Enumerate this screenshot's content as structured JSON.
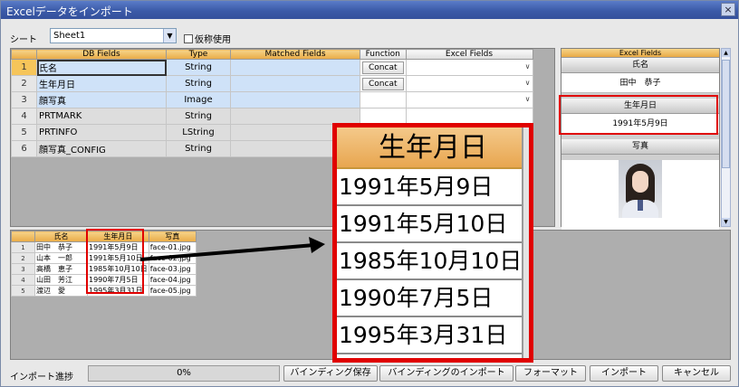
{
  "window": {
    "title": "Excelデータをインポート",
    "close": "×"
  },
  "sheet": {
    "label": "シート",
    "value": "Sheet1",
    "alias_label": "仮称使用"
  },
  "mapping": {
    "headers": {
      "db": "DB Fields",
      "type": "Type",
      "matched": "Matched Fields",
      "function": "Function",
      "excel": "Excel Fields"
    },
    "rows": [
      {
        "num": "1",
        "db": "氏名",
        "type": "String",
        "func": "Concat"
      },
      {
        "num": "2",
        "db": "生年月日",
        "type": "String",
        "func": "Concat"
      },
      {
        "num": "3",
        "db": "顔写真",
        "type": "Image",
        "func": ""
      },
      {
        "num": "4",
        "db": "PRTMARK",
        "type": "String",
        "func": ""
      },
      {
        "num": "5",
        "db": "PRTINFO",
        "type": "LString",
        "func": ""
      },
      {
        "num": "6",
        "db": "顔写真_CONFIG",
        "type": "String",
        "func": ""
      }
    ]
  },
  "preview": {
    "header": "Excel Fields",
    "fields": [
      {
        "label": "氏名",
        "value": "田中　恭子"
      },
      {
        "label": "生年月日",
        "value": "1991年5月9日"
      },
      {
        "label": "写真",
        "value": ""
      }
    ]
  },
  "data_table": {
    "headers": [
      "氏名",
      "生年月日",
      "写真"
    ],
    "rows": [
      {
        "num": "1",
        "name": "田中　恭子",
        "date": "1991年5月9日",
        "photo": "face-01.jpg"
      },
      {
        "num": "2",
        "name": "山本　一郎",
        "date": "1991年5月10日",
        "photo": "face-02.jpg"
      },
      {
        "num": "3",
        "name": "高橋　恵子",
        "date": "1985年10月10日",
        "photo": "face-03.jpg"
      },
      {
        "num": "4",
        "name": "山田　芳江",
        "date": "1990年7月5日",
        "photo": "face-04.jpg"
      },
      {
        "num": "5",
        "name": "渡辺　愛",
        "date": "1995年3月31日",
        "photo": "face-05.jpg"
      }
    ]
  },
  "zoom": {
    "header": "生年月日",
    "values": [
      "1991年5月9日",
      "1991年5月10日",
      "1985年10月10日",
      "1990年7月5日",
      "1995年3月31日"
    ]
  },
  "footer": {
    "progress_label": "インポート進捗",
    "progress": "0%",
    "buttons": [
      "バインディング保存",
      "バインディングのインポート",
      "フォーマット",
      "インポート",
      "キャンセル"
    ]
  },
  "colors": {
    "highlight": "#e00000",
    "header_orange": "#e9aa45",
    "titlebar": "#3b5aa8"
  }
}
